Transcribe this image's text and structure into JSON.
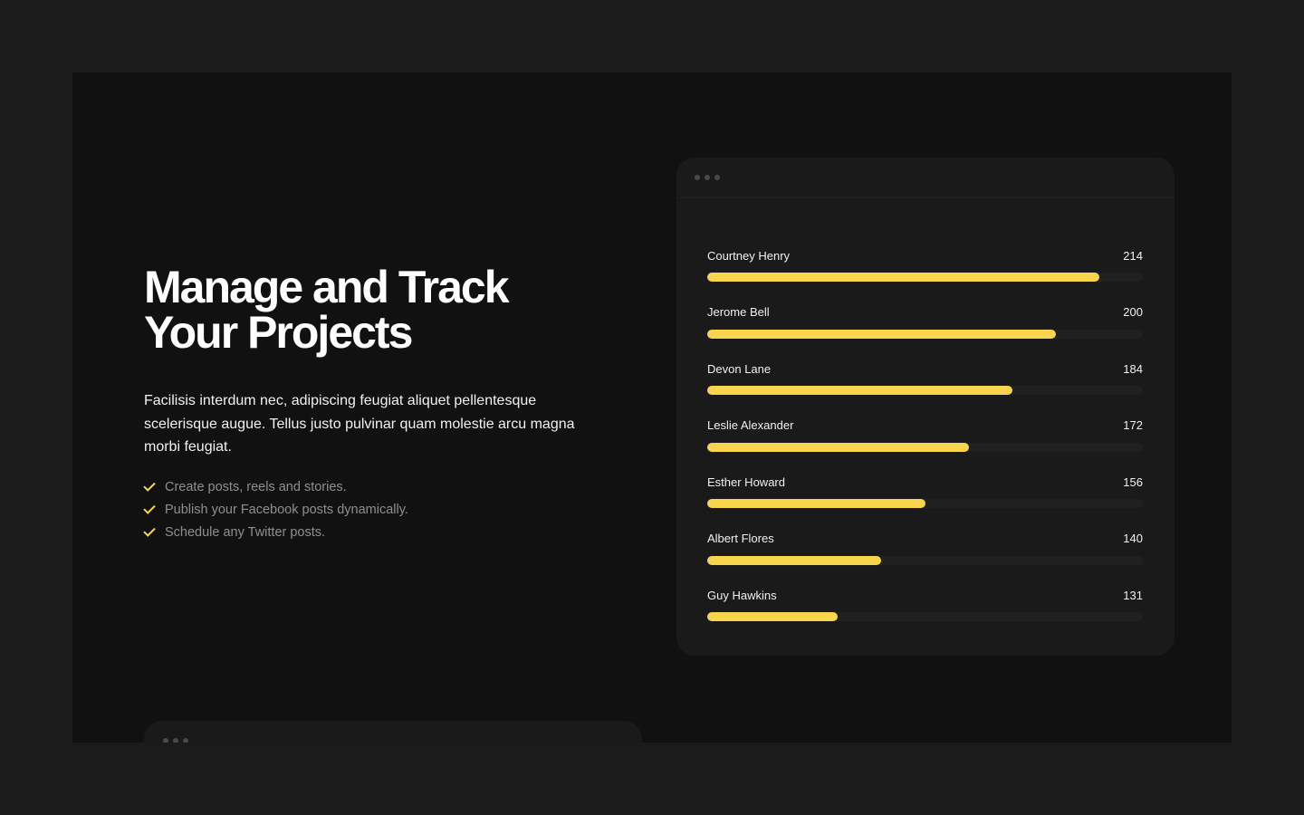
{
  "hero": {
    "title_line1": "Manage and Track",
    "title_line2": "Your Projects",
    "description": "Facilisis interdum nec, adipiscing feugiat aliquet pellentesque scelerisque augue. Tellus justo pulvinar quam molestie arcu magna morbi feugiat.",
    "features": [
      {
        "label": "Create posts, reels and stories.",
        "icon": "check-icon"
      },
      {
        "label": "Publish your Facebook posts dynamically.",
        "icon": "check-icon"
      },
      {
        "label": "Schedule any Twitter posts.",
        "icon": "check-icon"
      }
    ]
  },
  "leaderboard": {
    "window_controls": [
      "window-dot",
      "window-dot",
      "window-dot"
    ],
    "max_value": 240,
    "rows": [
      {
        "name": "Courtney Henry",
        "value": "214",
        "fill_fraction": 0.9
      },
      {
        "name": "Jerome Bell",
        "value": "200",
        "fill_fraction": 0.8
      },
      {
        "name": "Devon Lane",
        "value": "184",
        "fill_fraction": 0.7
      },
      {
        "name": "Leslie Alexander",
        "value": "172",
        "fill_fraction": 0.6
      },
      {
        "name": "Esther Howard",
        "value": "156",
        "fill_fraction": 0.5
      },
      {
        "name": "Albert Flores",
        "value": "140",
        "fill_fraction": 0.4
      },
      {
        "name": "Guy Hawkins",
        "value": "131",
        "fill_fraction": 0.3
      }
    ]
  },
  "colors": {
    "accent": "#f8d54c",
    "page_background": "#1b1b1b",
    "frame_background": "#111111",
    "card_background": "#1a1a1a"
  }
}
